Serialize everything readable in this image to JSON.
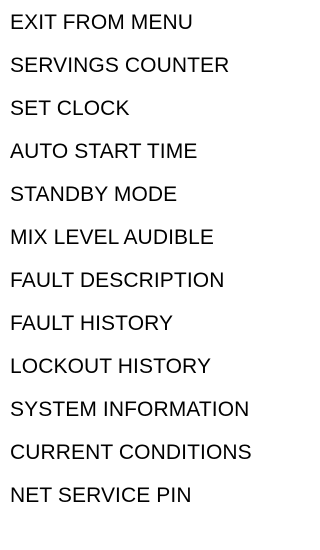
{
  "menu": {
    "items": [
      "EXIT FROM MENU",
      "SERVINGS COUNTER",
      "SET CLOCK",
      "AUTO START TIME",
      "STANDBY MODE",
      "MIX LEVEL AUDIBLE",
      "FAULT DESCRIPTION",
      "FAULT HISTORY",
      "LOCKOUT HISTORY",
      "SYSTEM INFORMATION",
      "CURRENT CONDITIONS",
      "NET SERVICE PIN"
    ]
  }
}
